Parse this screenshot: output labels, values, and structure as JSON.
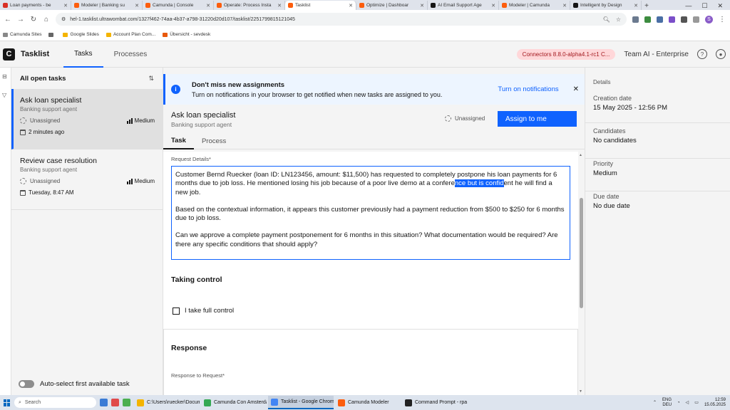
{
  "browser": {
    "tabs": [
      {
        "label": "Loan payments - be",
        "color": "#d93025",
        "active": false
      },
      {
        "label": "Modeler | Banking su",
        "color": "#fc5d0d",
        "active": false
      },
      {
        "label": "Camunda | Console",
        "color": "#fc5d0d",
        "active": false
      },
      {
        "label": "Operate: Process Insta",
        "color": "#fc5d0d",
        "active": false
      },
      {
        "label": "Tasklist",
        "color": "#fc5d0d",
        "active": true
      },
      {
        "label": "Optimize | Dashboar",
        "color": "#fc5d0d",
        "active": false
      },
      {
        "label": "AI Email Support Age",
        "color": "#161616",
        "active": false
      },
      {
        "label": "Modeler | Camunda",
        "color": "#fc5d0d",
        "active": false
      },
      {
        "label": "Intelligent by Design",
        "color": "#161616",
        "active": false
      }
    ],
    "new_tab": "+",
    "url": "hel-1.tasklist.ultrawombat.com/1327f462-74aa-4b37-a798-31220d20d107/tasklist/2251799815121045",
    "bookmarks": [
      {
        "label": "Camunda Sites",
        "color": "#888888"
      },
      {
        "label": "",
        "color": "#666666"
      },
      {
        "label": "Google Slides",
        "color": "#f4b400"
      },
      {
        "label": "Account Plan Com...",
        "color": "#f4b400"
      },
      {
        "label": "Übersicht - sevdesk",
        "color": "#e8590c"
      }
    ],
    "profile_initial": "S"
  },
  "app": {
    "name": "Tasklist",
    "logo": "C",
    "nav": [
      {
        "label": "Tasks",
        "active": true
      },
      {
        "label": "Processes",
        "active": false
      }
    ],
    "badge": "Connectors 8.8.0-alpha4.1-rc1 C...",
    "org": "Team AI - Enterprise"
  },
  "tasklist": {
    "filter": "All open tasks",
    "sort_icon": "⇅",
    "tasks": [
      {
        "name": "Ask loan specialist",
        "process": "Banking support agent",
        "assignee": "Unassigned",
        "priority": "Medium",
        "date": "2 minutes ago",
        "selected": true
      },
      {
        "name": "Review case resolution",
        "process": "Banking support agent",
        "assignee": "Unassigned",
        "priority": "Medium",
        "date": "Tuesday, 8:47 AM",
        "selected": false
      }
    ],
    "auto_select": "Auto-select first available task"
  },
  "notification": {
    "title": "Don't miss new assignments",
    "text": "Turn on notifications in your browser to get notified when new tasks are assigned to you.",
    "action": "Turn on notifications",
    "close": "✕"
  },
  "task": {
    "name": "Ask loan specialist",
    "process": "Banking support agent",
    "assignee": "Unassigned",
    "assign_button": "Assign to me",
    "tabs": [
      {
        "label": "Task",
        "active": true
      },
      {
        "label": "Process",
        "active": false
      }
    ],
    "form": {
      "request_label": "Request Details*",
      "request_text_1a": "Customer Bernd Ruecker (loan ID: LN123456, amount: $11,500) has requested to completely postpone his loan payments for 6 months due to job loss. He mentioned losing his job because of a poor live demo at a confere",
      "request_text_1_selected": "nce but is confid",
      "request_text_1b": "ent he will find a new job.",
      "request_text_2": "Based on the contextual information, it appears this customer previously had a payment reduction from $500 to $250 for 6 months due to job loss.",
      "request_text_3": "Can we approve a complete payment postponement for 6 months in this situation? What documentation would be required? Are there any specific conditions that should apply?",
      "taking_control_title": "Taking control",
      "take_control_checkbox": "I take full control",
      "response_title": "Response",
      "response_label": "Response to Request*"
    }
  },
  "details": {
    "heading": "Details",
    "creation_label": "Creation date",
    "creation_value": "15 May 2025 - 12:56 PM",
    "candidates_label": "Candidates",
    "candidates_value": "No candidates",
    "priority_label": "Priority",
    "priority_value": "Medium",
    "due_label": "Due date",
    "due_value": "No due date"
  },
  "taskbar": {
    "search": "Search",
    "apps": [
      {
        "label": "C:\\Users\\ruecker\\Docum",
        "color": "#f4b400",
        "active": false
      },
      {
        "label": "Camunda Con Amsterda",
        "color": "#34a853",
        "active": false
      },
      {
        "label": "Tasklist - Google Chrom",
        "color": "#4285f4",
        "active": true
      },
      {
        "label": "Camunda Modeler",
        "color": "#fc5d0d",
        "active": false
      },
      {
        "label": "Command Prompt - rpa",
        "color": "#222222",
        "active": false
      }
    ],
    "lang": "ENG",
    "lang2": "DEU",
    "time": "12:59",
    "date": "15.05.2025"
  }
}
